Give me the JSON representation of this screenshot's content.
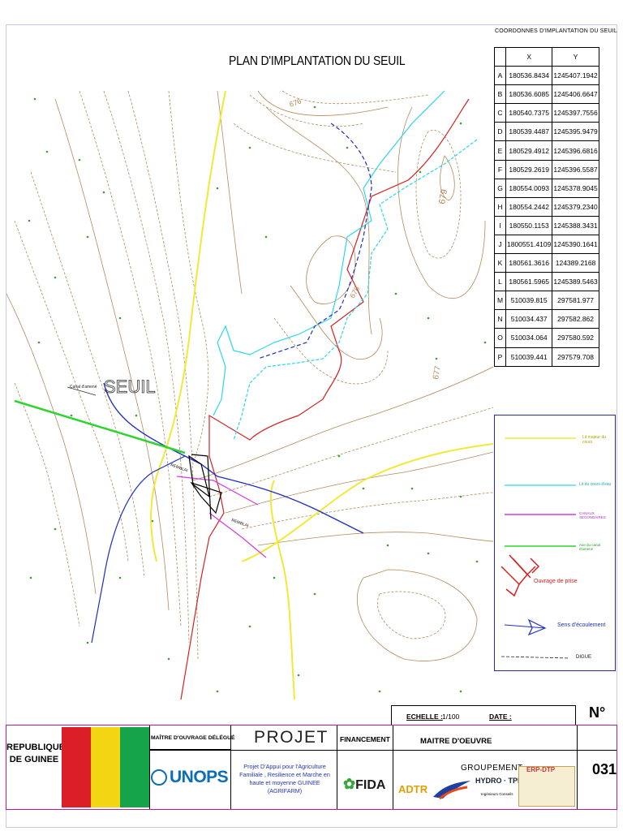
{
  "title": "PLAN D'IMPLANTATION DU SEUIL",
  "coordinates_title": "COORDONNES D'IMPLANTATION DU SEUIL",
  "coord_headers": [
    "X",
    "Y"
  ],
  "coords": [
    [
      "A",
      "180536.8434",
      "1245407.1942"
    ],
    [
      "B",
      "180536.6085",
      "1245406.6647"
    ],
    [
      "C",
      "180540.7375",
      "1245397.7556"
    ],
    [
      "D",
      "180539.4487",
      "1245395.9479"
    ],
    [
      "E",
      "180529.4912",
      "1245396.6816"
    ],
    [
      "F",
      "180529.2619",
      "1245396.5587"
    ],
    [
      "G",
      "180554.0093",
      "1245378.9045"
    ],
    [
      "H",
      "180554.2442",
      "1245379.2340"
    ],
    [
      "I",
      "180550.1153",
      "1245388.3431"
    ],
    [
      "J",
      "1800551.4109",
      "1245390.1641"
    ],
    [
      "K",
      "180561.3616",
      "124389.2168"
    ],
    [
      "L",
      "180561.5965",
      "1245389.5463"
    ],
    [
      "M",
      "510039.815",
      "297581.977"
    ],
    [
      "N",
      "510034.437",
      "297582.862"
    ],
    [
      "O",
      "510034.064",
      "297580.592"
    ],
    [
      "P",
      "510039.441",
      "297579.708"
    ]
  ],
  "map_labels": {
    "seuil": "SEUIL",
    "canal": "Canal d'amené",
    "remblai1": "REMBLAI",
    "remblai2": "REMBLAI",
    "contour_676": "676",
    "contour_678": "678",
    "contour_679": "679",
    "contour_677": "677"
  },
  "legend": {
    "item1": "Lit majeur du cours",
    "item2": "Lit du cours d'eau",
    "item3": "CANAUX SECONDAIRES",
    "item4": "Axe du canal d'amené",
    "item5": "Ouvrage de prise",
    "item6": "Sens d'écoulement",
    "item7": "DIGUE"
  },
  "colors": {
    "legend_border": "#2a2aa8",
    "contour": "#b5895a",
    "red_line": "#d32222",
    "cyan_line": "#2ad8e6",
    "yellow_line": "#f2e838",
    "magenta_line": "#d43be0",
    "green_line": "#2fd52f",
    "blue_line": "#1d2fc2",
    "title_block_border": "#c2188f"
  },
  "title_block": {
    "echelle_label": "ECHELLE :",
    "echelle_value": "1/100",
    "date_label": "DATE :",
    "no_label": "N°",
    "republique": "REPUBLIQUE DE GUINEE",
    "maitre_ouvrage": "MAÎTRE D'OUVRAGE DÉLÉGUÉ",
    "unops": "UNOPS",
    "projet": "PROJET",
    "projet_desc": "Projet D'Appui pour l'Agriculture Familiale , Resilience et Marche en haute et moyenne GUINEE (AGRIFARM)",
    "financement": "FINANCEMENT",
    "fida": "FIDA",
    "maitre_oeuvre": "MAITRE D'OEUVRE",
    "groupement": "GROUPEMENT",
    "adtr": "ADTR",
    "hydro": "HYDRO · TPE",
    "hydro_sub": "Ingénieurs Conseils",
    "erp": "ERP-DTP",
    "drawing_number": "031"
  }
}
